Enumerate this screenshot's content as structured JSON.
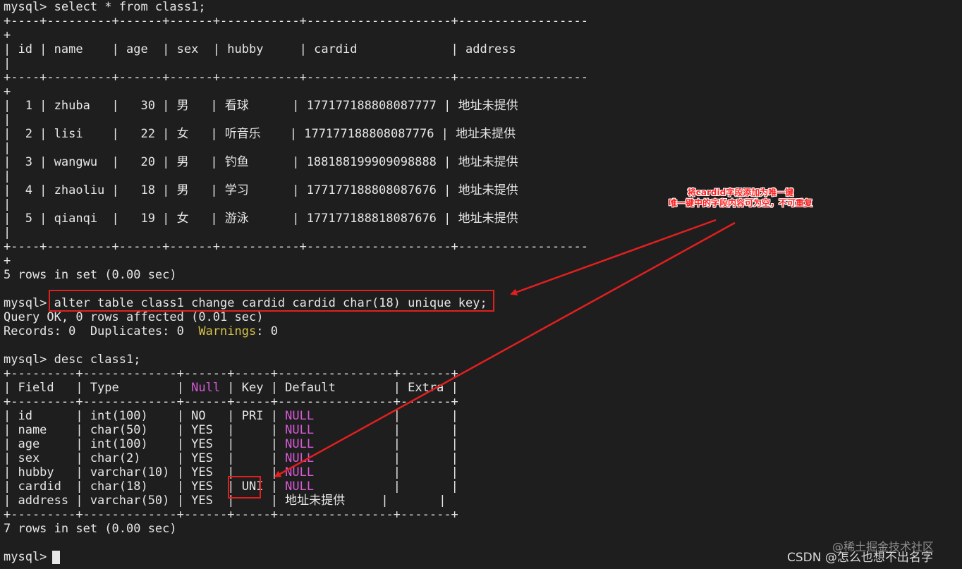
{
  "terminal": {
    "lines": [
      [
        {
          "t": "mysql> select * from class1;"
        }
      ],
      [
        {
          "t": "+----+---------+------+------+-----------+--------------------+------------------"
        }
      ],
      [
        {
          "t": "+"
        }
      ],
      [
        {
          "t": "| id | name    | age  | sex  | hubby     | cardid             | address"
        }
      ],
      [
        {
          "t": "|"
        }
      ],
      [
        {
          "t": "+----+---------+------+------+-----------+--------------------+------------------"
        }
      ],
      [
        {
          "t": "+"
        }
      ],
      [
        {
          "t": "|  1 | zhuba   |   30 | 男   | 看球      | 177177188808087777 | 地址未提供"
        }
      ],
      [
        {
          "t": "|"
        }
      ],
      [
        {
          "t": "|  2 | lisi    |   22 | 女   | 听音乐    | 177177188808087776 | 地址未提供"
        }
      ],
      [
        {
          "t": "|"
        }
      ],
      [
        {
          "t": "|  3 | wangwu  |   20 | 男   | 钓鱼      | 188188199909098888 | 地址未提供"
        }
      ],
      [
        {
          "t": "|"
        }
      ],
      [
        {
          "t": "|  4 | zhaoliu |   18 | 男   | 学习      | 177177188808087676 | 地址未提供"
        }
      ],
      [
        {
          "t": "|"
        }
      ],
      [
        {
          "t": "|  5 | qianqi  |   19 | 女   | 游泳      | 177177188818087676 | 地址未提供"
        }
      ],
      [
        {
          "t": "|"
        }
      ],
      [
        {
          "t": "+----+---------+------+------+-----------+--------------------+------------------"
        }
      ],
      [
        {
          "t": "+"
        }
      ],
      [
        {
          "t": "5 rows in set (0.00 sec)"
        }
      ],
      [
        {
          "t": ""
        }
      ],
      [
        {
          "t": "mysql> alter table class1 change cardid cardid char(18) unique key;"
        }
      ],
      [
        {
          "t": "Query OK, 0 rows affected (0.01 sec)"
        }
      ],
      [
        {
          "t": "Records: 0  Duplicates: 0  "
        },
        {
          "t": "Warnings",
          "c": "yellow"
        },
        {
          "t": ": 0"
        }
      ],
      [
        {
          "t": ""
        }
      ],
      [
        {
          "t": "mysql> desc class1;"
        }
      ],
      [
        {
          "t": "+---------+-------------+------+-----+----------------+-------+"
        }
      ],
      [
        {
          "t": "| Field   | Type        | "
        },
        {
          "t": "Null",
          "c": "magenta"
        },
        {
          "t": " | Key | Default        | Extra |"
        }
      ],
      [
        {
          "t": "+---------+-------------+------+-----+----------------+-------+"
        }
      ],
      [
        {
          "t": "| id      | int(100)    | NO   | PRI | "
        },
        {
          "t": "NULL",
          "c": "magenta"
        },
        {
          "t": "           |       |"
        }
      ],
      [
        {
          "t": "| name    | char(50)    | YES  |     | "
        },
        {
          "t": "NULL",
          "c": "magenta"
        },
        {
          "t": "           |       |"
        }
      ],
      [
        {
          "t": "| age     | int(100)    | YES  |     | "
        },
        {
          "t": "NULL",
          "c": "magenta"
        },
        {
          "t": "           |       |"
        }
      ],
      [
        {
          "t": "| sex     | char(2)     | YES  |     | "
        },
        {
          "t": "NULL",
          "c": "magenta"
        },
        {
          "t": "           |       |"
        }
      ],
      [
        {
          "t": "| hubby   | varchar(10) | YES  |     | "
        },
        {
          "t": "NULL",
          "c": "magenta"
        },
        {
          "t": "           |       |"
        }
      ],
      [
        {
          "t": "| cardid  | char(18)    | YES  | UNI | "
        },
        {
          "t": "NULL",
          "c": "magenta"
        },
        {
          "t": "           |       |"
        }
      ],
      [
        {
          "t": "| address | varchar(50) | YES  |     | 地址未提供     |       |"
        }
      ],
      [
        {
          "t": "+---------+-------------+------+-----+----------------+-------+"
        }
      ],
      [
        {
          "t": "7 rows in set (0.00 sec)"
        }
      ],
      [
        {
          "t": ""
        }
      ],
      [
        {
          "t": "mysql> "
        }
      ]
    ]
  },
  "annotation": {
    "line1": "将cardid字段添加为唯一键",
    "line2": "唯一键中的字段内容可为空，不可重复"
  },
  "watermarks": {
    "faded": "@稀土掘金技术社区",
    "csdn": "CSDN @怎么也想不出名字"
  },
  "colors": {
    "background": "#1e1e1e",
    "text": "#e6e6e6",
    "null_keyword": "#d65ad6",
    "warnings": "#d7c24a",
    "annotation_red": "#e21f1f"
  }
}
